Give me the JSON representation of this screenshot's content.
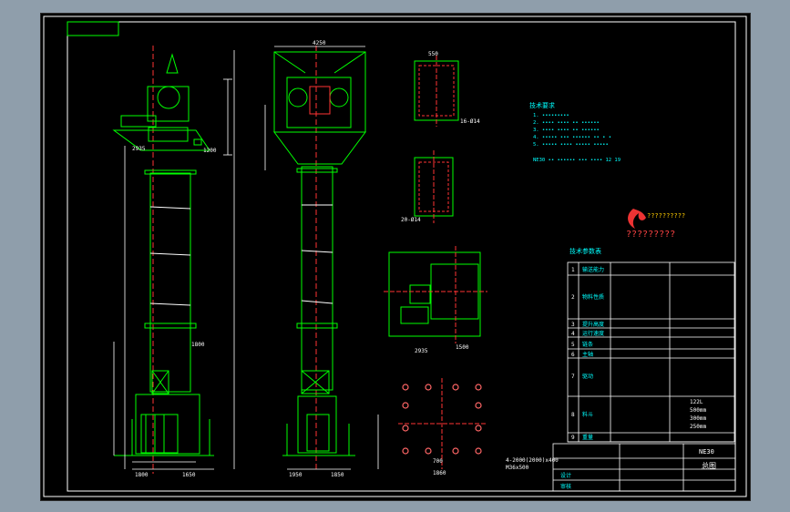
{
  "drawing": {
    "dims": {
      "top_width": "4250",
      "front_left_a": "2935",
      "front_left_b": "1200",
      "mid_mark": "1800",
      "bottom_a": "1800",
      "bottom_b": "1650",
      "side_bottom_a": "1950",
      "side_bottom_b": "1850",
      "boot_a": "2935",
      "boot_b": "1500",
      "plan_pitch": "700",
      "plan_total": "1860",
      "anchor_note": "4-2000(2000)x400",
      "anchor_note2": "M36x500",
      "sec1_w": "550",
      "sec1_h": "500",
      "sec1_bolts": "16-Ø14",
      "sec2_bolts": "20-Ø14"
    },
    "tech_title": "技术要求",
    "tech_lines": [
      "1. •••••••••",
      "2. •••• •••• •• ••••••",
      "3. •••• •••• •• ••••••",
      "4. ••••• ••• •••••• •• • •",
      "5. ••••• •••• ••••• •••••",
      "NE30 •• •••••• ••• •••• 12 19"
    ],
    "logo_text": "??????????",
    "logo_sub": "?????????",
    "table": {
      "title": "技术参数表",
      "rows": [
        {
          "no": "1",
          "label": "输送能力",
          "value": ""
        },
        {
          "no": "2",
          "label": "物料性质",
          "value": ""
        },
        {
          "no": "3",
          "label": "提升高度",
          "value": ""
        },
        {
          "no": "4",
          "label": "运行速度",
          "value": ""
        },
        {
          "no": "5",
          "label": "链条",
          "value": ""
        },
        {
          "no": "6",
          "label": "主轴",
          "value": ""
        },
        {
          "no": "7",
          "label": "驱动",
          "value": ""
        },
        {
          "no": "8",
          "label": "料斗",
          "value": ""
        },
        {
          "no": "9",
          "label": "重量",
          "value": ""
        }
      ],
      "hopper_vals": [
        "122L",
        "500mm",
        "300mm",
        "250mm"
      ]
    },
    "titleblock": {
      "code": "NE30",
      "name": "总图",
      "label_a": "设计",
      "label_b": "审核"
    }
  }
}
